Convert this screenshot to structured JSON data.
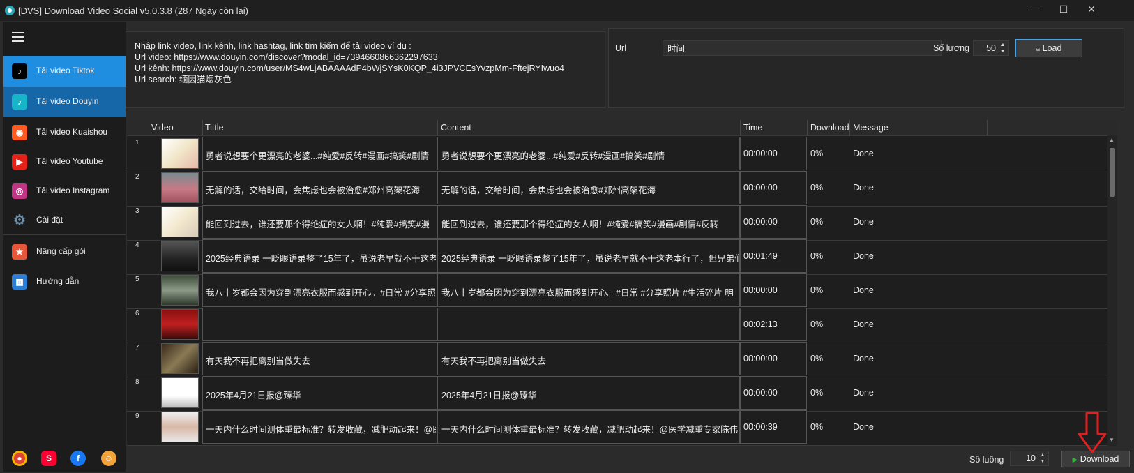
{
  "window": {
    "title": "[DVS] Download Video Social v5.0.3.8 (287 Ngày còn lại)",
    "minimize_glyph": "—",
    "maximize_glyph": "☐",
    "close_glyph": "✕"
  },
  "sidebar": {
    "items": [
      {
        "label": "Tải video Tiktok",
        "icon": "tiktok-icon"
      },
      {
        "label": "Tải video Douyin",
        "icon": "douyin-icon"
      },
      {
        "label": "Tải video Kuaishou",
        "icon": "kuaishou-icon"
      },
      {
        "label": "Tải video Youtube",
        "icon": "youtube-icon"
      },
      {
        "label": "Tải video Instagram",
        "icon": "instagram-icon"
      },
      {
        "label": "Cài đặt",
        "icon": "gear-icon"
      },
      {
        "label": "Nâng cấp gói",
        "icon": "tag-icon"
      },
      {
        "label": "Hướng dẫn",
        "icon": "guide-icon"
      }
    ],
    "bottom_icons": [
      "chrome-icon",
      "youtube-shorts-icon",
      "facebook-icon",
      "support-agent-icon"
    ]
  },
  "hint": {
    "text": "Nhập link video, link kênh, link hashtag, link tìm kiếm để tải video ví dụ :\nUrl video: https://www.douyin.com/discover?modal_id=7394660866362297633\nUrl kênh: https://www.douyin.com/user/MS4wLjABAAAAdP4bWjSYsK0KQP_4i3JPVCEsYvzpMm-FftejRYIwuo4\nUrl search: 缅因猫烟灰色"
  },
  "url_form": {
    "url_label": "Url",
    "url_value": "时间",
    "quantity_label": "Số lượng",
    "quantity_value": "50",
    "load_label": "Load",
    "load_icon": "⤓"
  },
  "table": {
    "columns": [
      "Video",
      "Tittle",
      "Content",
      "Time",
      "Download",
      "Message"
    ],
    "rows": [
      {
        "n": "1",
        "title": "勇者说想要个更漂亮的老婆...#纯爱#反转#漫画#搞笑#剧情",
        "content": "勇者说想要个更漂亮的老婆...#纯爱#反转#漫画#搞笑#剧情",
        "time": "00:00:00",
        "download": "0%",
        "message": "Done"
      },
      {
        "n": "2",
        "title": "无解的话，交给时间，会焦虑也会被治愈#郑州高架花海",
        "content": "无解的话，交给时间，会焦虑也会被治愈#郑州高架花海",
        "time": "00:00:00",
        "download": "0%",
        "message": "Done"
      },
      {
        "n": "3",
        "title": "能回到过去，谁还要那个得绝症的女人啊！#纯爱#搞笑#漫",
        "content": "能回到过去，谁还要那个得绝症的女人啊！#纯爱#搞笑#漫画#剧情#反转",
        "time": "00:00:00",
        "download": "0%",
        "message": "Done"
      },
      {
        "n": "4",
        "title": "2025经典语录 一眨眼语录整了15年了，虽说老早就不干这老",
        "content": "2025经典语录 一眨眼语录整了15年了，虽说老早就不干这老本行了，但兄弟们",
        "time": "00:01:49",
        "download": "0%",
        "message": "Done"
      },
      {
        "n": "5",
        "title": "我八十岁都会因为穿到漂亮衣服而感到开心。#日常 #分享照",
        "content": "我八十岁都会因为穿到漂亮衣服而感到开心。#日常 #分享照片 #生活碎片 明",
        "time": "00:00:00",
        "download": "0%",
        "message": "Done"
      },
      {
        "n": "6",
        "title": "",
        "content": "",
        "time": "00:02:13",
        "download": "0%",
        "message": "Done"
      },
      {
        "n": "7",
        "title": "有天我不再把离别当做失去",
        "content": "有天我不再把离别当做失去",
        "time": "00:00:00",
        "download": "0%",
        "message": "Done"
      },
      {
        "n": "8",
        "title": "2025年4月21日报@臻华",
        "content": "2025年4月21日报@臻华",
        "time": "00:00:00",
        "download": "0%",
        "message": "Done"
      },
      {
        "n": "9",
        "title": "一天内什么时间测体重最标准？转发收藏，减肥动起来！@医",
        "content": "一天内什么时间测体重最标准？转发收藏，减肥动起来！@医学减重专家陈伟",
        "time": "00:00:39",
        "download": "0%",
        "message": "Done"
      }
    ]
  },
  "footer": {
    "threads_label": "Số luồng",
    "threads_value": "10",
    "download_label": "Download",
    "download_icon": "▶"
  },
  "colors": {
    "accent_tiktok": "#1f8ee0",
    "accent_douyin": "#1667a8",
    "annotation_arrow": "#e02020"
  }
}
